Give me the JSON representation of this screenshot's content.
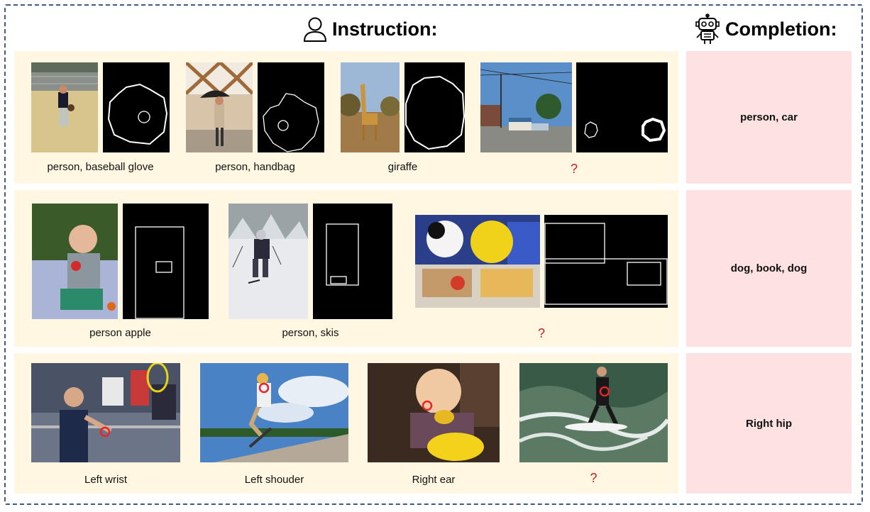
{
  "headers": {
    "instruction": "Instruction:",
    "completion": "Completion:"
  },
  "icons": {
    "instruction": "person-icon",
    "completion": "robot-icon"
  },
  "colors": {
    "row_bg": "#fff7e1",
    "completion_bg": "#fde2e1",
    "frame_border": "#3e5a86",
    "question_mark": "#d01c1c",
    "keypoint_circle": "#e3262b"
  },
  "rows": [
    {
      "examples": [
        {
          "caption": "person, baseball glove"
        },
        {
          "caption": "person, handbag"
        },
        {
          "caption": "giraffe"
        }
      ],
      "query": "?",
      "completion": "person, car"
    },
    {
      "examples": [
        {
          "caption": "person apple"
        },
        {
          "caption": "person, skis"
        }
      ],
      "query": "?",
      "completion": "dog, book, dog"
    },
    {
      "examples": [
        {
          "caption": "Left wrist"
        },
        {
          "caption": "Left shouder"
        },
        {
          "caption": "Right ear"
        }
      ],
      "query": "?",
      "completion": "Right hip"
    }
  ]
}
